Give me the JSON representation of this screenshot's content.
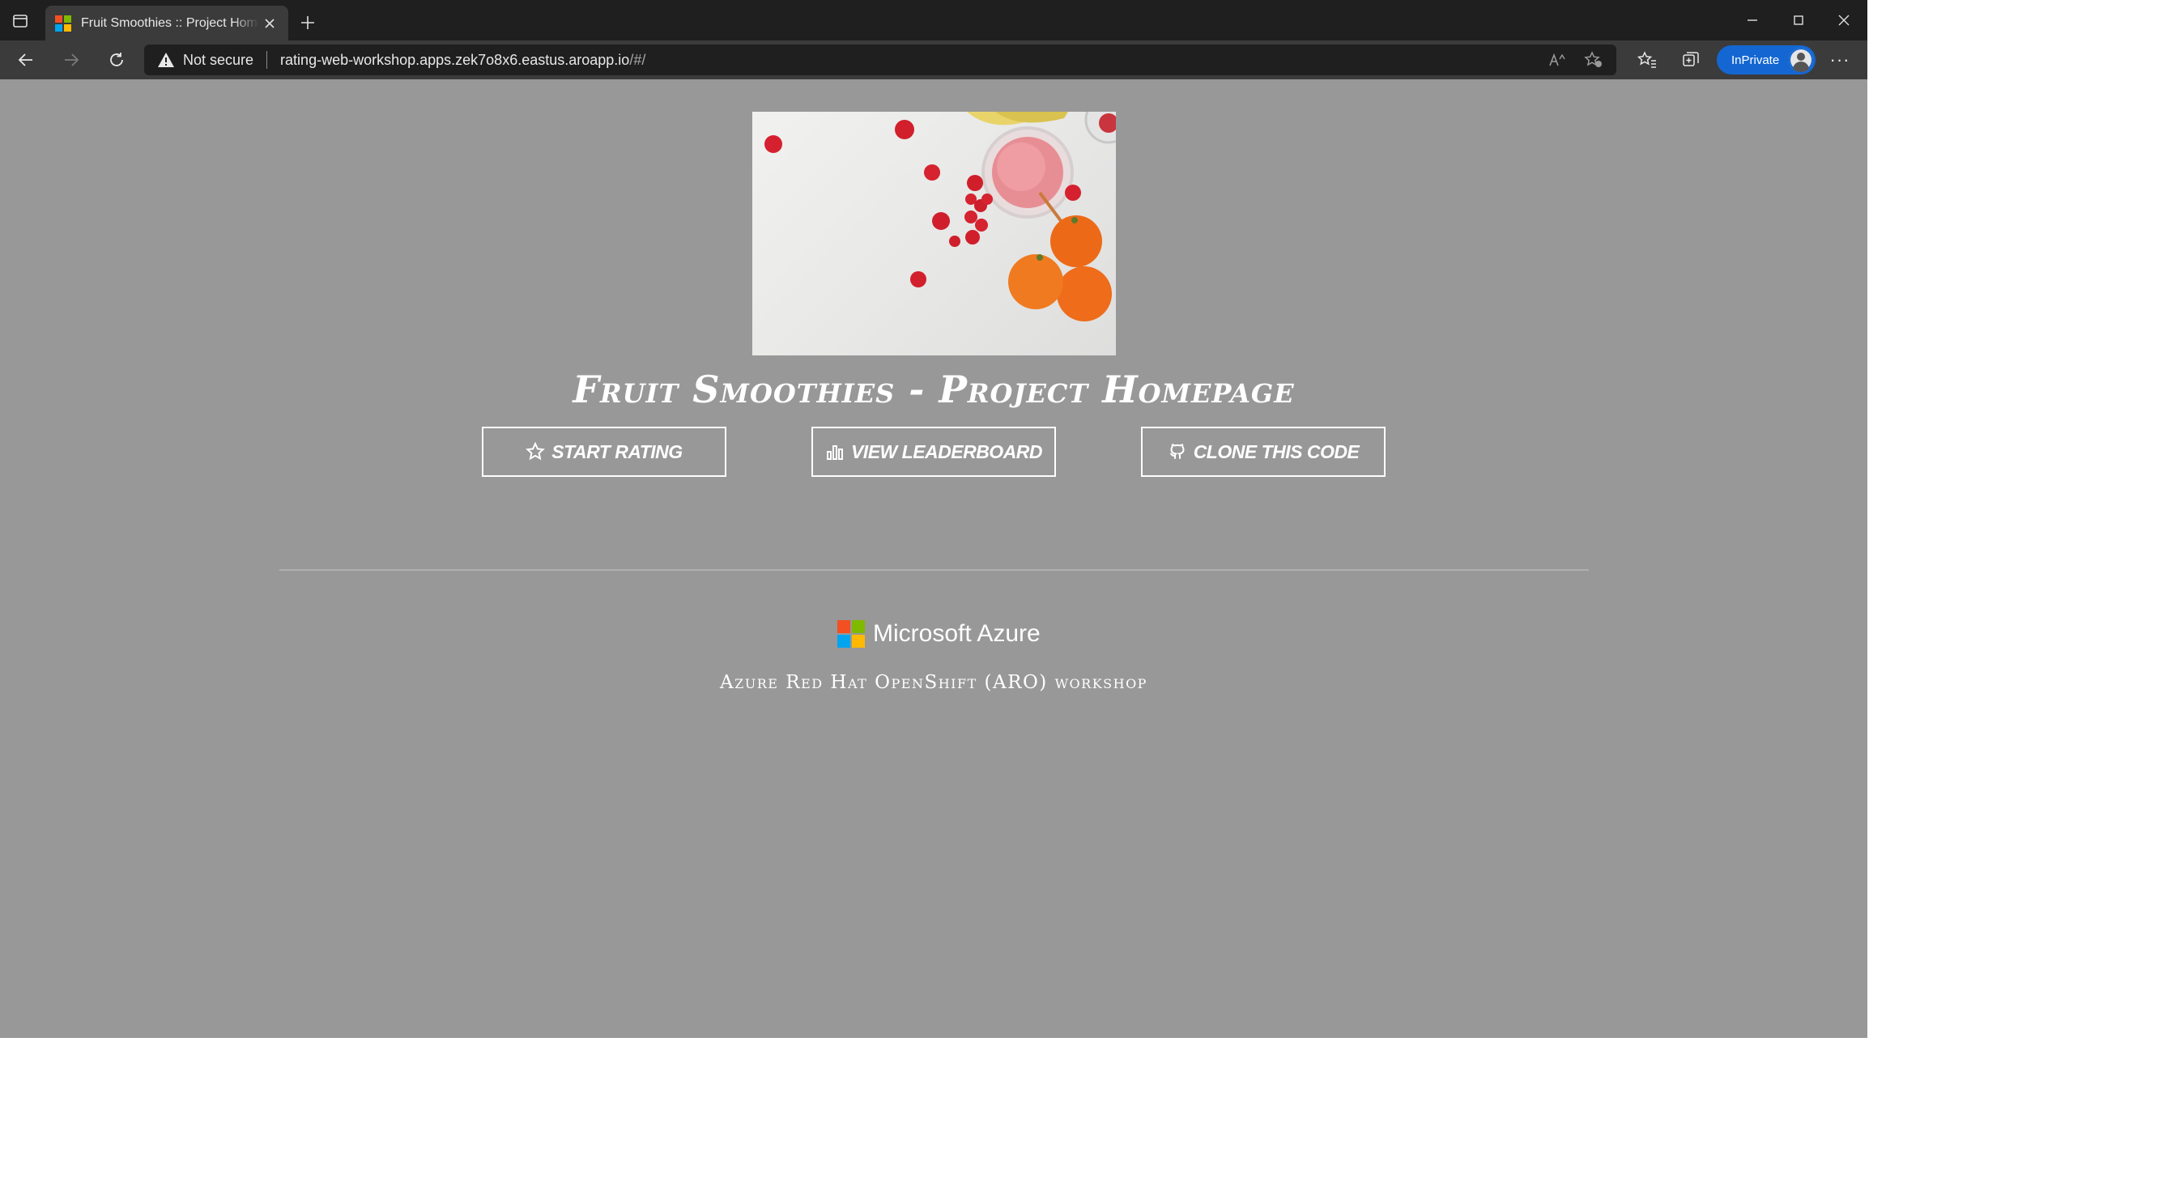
{
  "browser": {
    "tab": {
      "title": "Fruit Smoothies :: Project Homepage",
      "favicon_colors": [
        "#f25022",
        "#7fba00",
        "#00a4ef",
        "#ffb900"
      ]
    },
    "address_bar": {
      "security_label": "Not secure",
      "url_host": "rating-web-workshop.apps.zek7o8x6.eastus.aroapp.io",
      "url_path": "/#/"
    },
    "profile": {
      "label": "InPrivate",
      "color": "#1467d2"
    },
    "more_label": "···"
  },
  "page": {
    "title": "Fruit Smoothies - Project Homepage",
    "buttons": [
      {
        "label": "Start Rating",
        "icon": "star-icon"
      },
      {
        "label": "View Leaderboard",
        "icon": "bar-chart-icon"
      },
      {
        "label": "Clone this code",
        "icon": "github-icon"
      }
    ],
    "footer": {
      "brand": "Microsoft Azure",
      "subtitle": "Azure Red Hat OpenShift (ARO) workshop"
    },
    "colors": {
      "page_background": "#989898",
      "text": "#ffffff"
    }
  }
}
